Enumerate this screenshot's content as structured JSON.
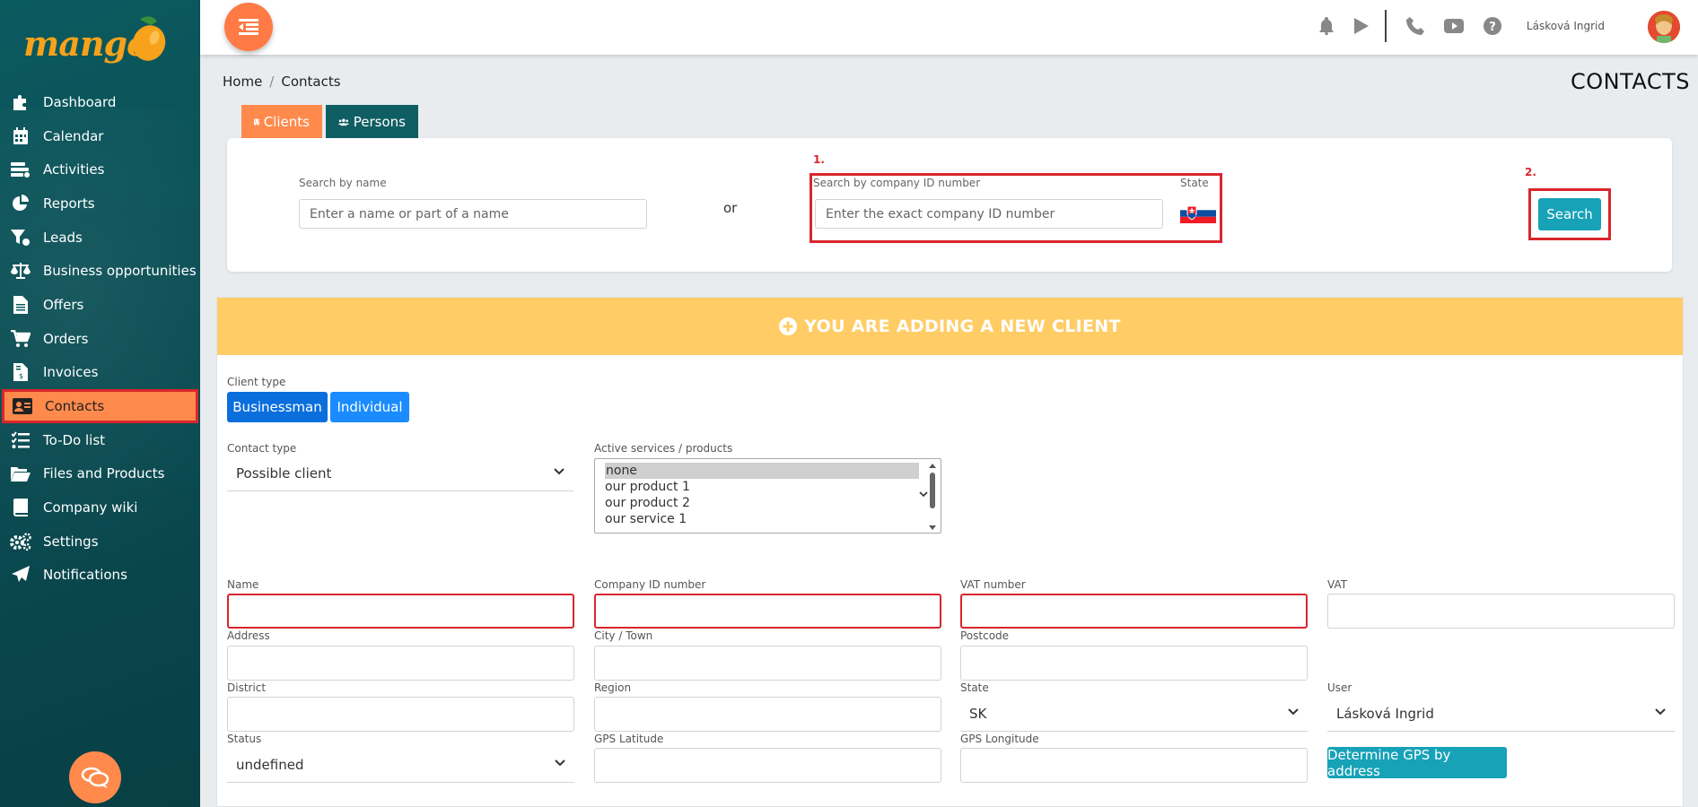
{
  "app": {
    "brand": "mango"
  },
  "sidebar": {
    "items": [
      {
        "label": "Dashboard",
        "icon": "puzzle-icon"
      },
      {
        "label": "Calendar",
        "icon": "calendar-icon"
      },
      {
        "label": "Activities",
        "icon": "activities-icon"
      },
      {
        "label": "Reports",
        "icon": "pie-chart-icon"
      },
      {
        "label": "Leads",
        "icon": "funnel-icon"
      },
      {
        "label": "Business opportunities",
        "icon": "scale-icon"
      },
      {
        "label": "Offers",
        "icon": "document-icon"
      },
      {
        "label": "Orders",
        "icon": "cart-icon"
      },
      {
        "label": "Invoices",
        "icon": "invoice-icon"
      },
      {
        "label": "Contacts",
        "icon": "contact-card-icon",
        "active": true
      },
      {
        "label": "To-Do list",
        "icon": "checklist-icon"
      },
      {
        "label": "Files and Products",
        "icon": "folder-icon"
      },
      {
        "label": "Company wiki",
        "icon": "book-icon"
      },
      {
        "label": "Settings",
        "icon": "gears-icon"
      },
      {
        "label": "Notifications",
        "icon": "paper-plane-icon"
      }
    ]
  },
  "topbar": {
    "user_name": "Lásková Ingrid"
  },
  "breadcrumb": {
    "home": "Home",
    "separator": "/",
    "current": "Contacts"
  },
  "page_title": "CONTACTS",
  "tabs": {
    "clients": "Clients",
    "persons": "Persons"
  },
  "search": {
    "name_label": "Search by name",
    "name_placeholder": "Enter a name or part of a name",
    "or": "or",
    "id_label": "Search by company ID number",
    "id_placeholder": "Enter the exact company ID number",
    "state_label": "State",
    "button": "Search",
    "annotation_1": "1.",
    "annotation_2": "2."
  },
  "new_client": {
    "header": "YOU ARE ADDING A NEW CLIENT",
    "client_type_label": "Client type",
    "client_type_options": [
      "Businessman",
      "Individual"
    ],
    "contact_type_label": "Contact type",
    "contact_type_value": "Possible client",
    "services_label": "Active services / products",
    "services_options": [
      "none",
      "our product 1",
      "our product 2",
      "our service 1"
    ],
    "fields": {
      "name": "Name",
      "company_id": "Company ID number",
      "vat_number": "VAT number",
      "vat": "VAT",
      "address": "Address",
      "city": "City / Town",
      "postcode": "Postcode",
      "district": "District",
      "region": "Region",
      "state": "State",
      "state_value": "SK",
      "user": "User",
      "user_value": "Lásková Ingrid",
      "status": "Status",
      "status_value": "undefined",
      "gps_lat": "GPS Latitude",
      "gps_lon": "GPS Longitude",
      "gps_button": "Determine GPS by address"
    }
  },
  "colors": {
    "accent_orange": "#ff8a4c",
    "teal": "#0f5e63",
    "annotation_red": "#d9262c",
    "header_yellow": "#ffcc66",
    "button_teal": "#17a2b8"
  }
}
